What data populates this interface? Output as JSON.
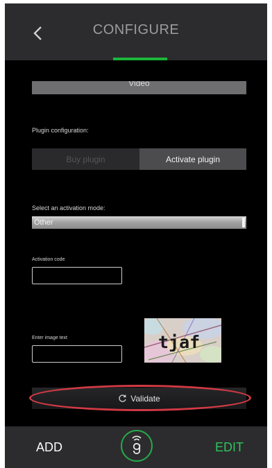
{
  "header": {
    "title": "CONFIGURE",
    "back_icon": "chevron-left-icon",
    "accent_color": "#1db53a"
  },
  "form": {
    "video_label": "Video",
    "plugin_config_label": "Plugin configuration:",
    "segmented": {
      "buy_label": "Buy plugin",
      "activate_label": "Activate plugin",
      "selected": "Activate plugin"
    },
    "activation_mode_label": "Select an activation mode:",
    "activation_mode_value": "Other",
    "activation_code_label": "Activation code",
    "activation_code_value": "",
    "image_text_label": "Enter image text",
    "image_text_value": "",
    "captcha_text": "tjaf",
    "validate_label": "Validate",
    "validate_icon": "refresh-icon"
  },
  "footer": {
    "add_label": "ADD",
    "edit_label": "EDIT",
    "logo_icon": "app-logo-icon",
    "edit_color": "#2fc55c"
  },
  "annotation": {
    "highlight_color": "#d23a45"
  }
}
